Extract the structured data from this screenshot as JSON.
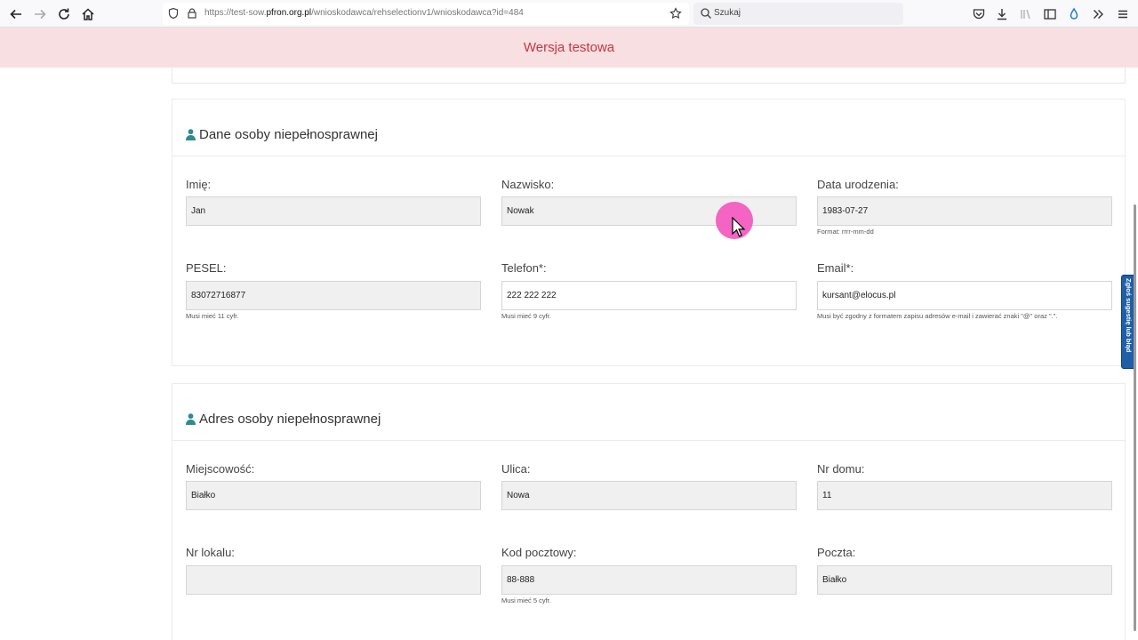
{
  "browser": {
    "url_prefix": "https://test-sow.",
    "url_domain": "pfron.org.pl",
    "url_path": "/wnioskodawca/rehselectionv1/wnioskodawca?id=484",
    "search_placeholder": "Szukaj"
  },
  "banner": {
    "text": "Wersja testowa"
  },
  "section_person": {
    "title": "Dane osoby niepełnosprawnej",
    "fields": {
      "first_name": {
        "label": "Imię:",
        "value": "Jan"
      },
      "last_name": {
        "label": "Nazwisko:",
        "value": "Nowak"
      },
      "birth_date": {
        "label": "Data urodzenia:",
        "value": "1983-07-27",
        "help": "Format: rrrr-mm-dd"
      },
      "pesel": {
        "label": "PESEL:",
        "value": "83072716877",
        "help": "Musi mieć 11 cyfr."
      },
      "phone": {
        "label": "Telefon*:",
        "value": "222 222 222",
        "help": "Musi mieć 9 cyfr."
      },
      "email": {
        "label": "Email*:",
        "value": "kursant@elocus.pl",
        "help": "Musi być zgodny z formatem zapisu adresów e-mail i zawierać znaki \"@\" oraz \".\"."
      }
    }
  },
  "section_address": {
    "title": "Adres osoby niepełnosprawnej",
    "fields": {
      "city": {
        "label": "Miejscowość:",
        "value": "Białko"
      },
      "street": {
        "label": "Ulica:",
        "value": "Nowa"
      },
      "house_no": {
        "label": "Nr domu:",
        "value": "11"
      },
      "flat_no": {
        "label": "Nr lokalu:",
        "value": ""
      },
      "postal_code": {
        "label": "Kod pocztowy:",
        "value": "88-888",
        "help": "Musi mieć 5 cyfr."
      },
      "post_office": {
        "label": "Poczta:",
        "value": "Białko"
      }
    }
  },
  "feedback_tab": {
    "label": "Zgłoś sugestię lub błąd"
  },
  "colors": {
    "banner_bg": "#f8dfe2",
    "banner_text": "#c9353f",
    "icon_teal": "#2f8a92",
    "feedback_bg": "#1f5fa8",
    "cursor_highlight": "#f25cc0"
  }
}
